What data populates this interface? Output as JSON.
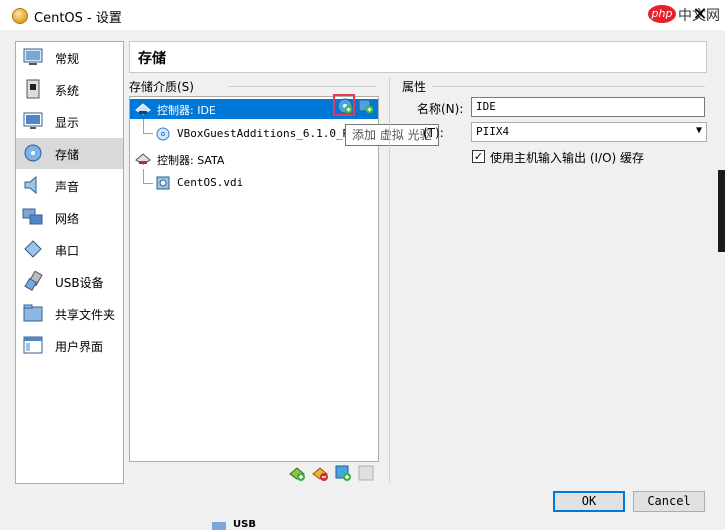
{
  "window": {
    "title": "CentOS - 设置",
    "close_glyph": "✕"
  },
  "watermark": {
    "logo": "php",
    "text": "中文网"
  },
  "nav": {
    "items": [
      {
        "label": "常规",
        "icon": "general-icon",
        "selected": false
      },
      {
        "label": "系统",
        "icon": "system-icon",
        "selected": false
      },
      {
        "label": "显示",
        "icon": "display-icon",
        "selected": false
      },
      {
        "label": "存储",
        "icon": "storage-icon",
        "selected": true
      },
      {
        "label": "声音",
        "icon": "audio-icon",
        "selected": false
      },
      {
        "label": "网络",
        "icon": "network-icon",
        "selected": false
      },
      {
        "label": "串口",
        "icon": "serial-port-icon",
        "selected": false
      },
      {
        "label": "USB设备",
        "icon": "usb-icon",
        "selected": false
      },
      {
        "label": "共享文件夹",
        "icon": "shared-folder-icon",
        "selected": false
      },
      {
        "label": "用户界面",
        "icon": "user-interface-icon",
        "selected": false
      }
    ]
  },
  "page": {
    "title": "存储"
  },
  "storage": {
    "media_label": "存储介质(S)",
    "tree": [
      {
        "label": "控制器: IDE",
        "kind": "controller",
        "selected": true
      },
      {
        "label": "VBoxGuestAdditions_6.1.0_RC1",
        "kind": "optical-disk"
      },
      {
        "label": "控制器: SATA",
        "kind": "controller",
        "selected": false
      },
      {
        "label": "CentOS.vdi",
        "kind": "hard-disk"
      }
    ],
    "tooltip": "添加 虚拟 光驱"
  },
  "attributes": {
    "section_label": "属性",
    "name_label": "名称(N):",
    "name_value": "IDE",
    "type_label": "(T):",
    "type_value": "PIIX4",
    "cache_checked": true,
    "cache_check_glyph": "✓",
    "cache_label": "使用主机输入输出 (I/O) 缓存"
  },
  "buttons": {
    "ok": "OK",
    "cancel": "Cancel"
  },
  "background": {
    "peek_text": "USB"
  },
  "colors": {
    "selection": "#0078d7",
    "highlight": "#e53a5a",
    "focus": "#0078d7"
  }
}
